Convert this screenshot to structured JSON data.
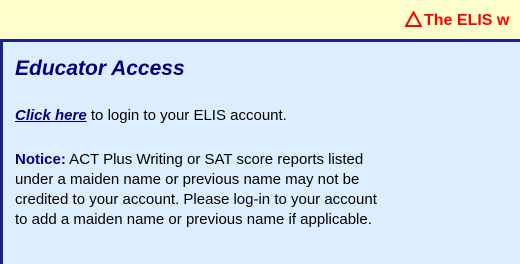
{
  "alert": {
    "icon": "warning-triangle-icon",
    "text": "The ELIS w",
    "color": "#ff0000",
    "background": "#ffffcc"
  },
  "panel": {
    "title": "Educator Access",
    "background": "#ddeeff",
    "accent": "#000080",
    "login_link": "Click here",
    "login_text": " to login to your ELIS account.",
    "notice_label": "Notice:",
    "notice_lines": [
      " ACT Plus Writing or SAT score reports listed",
      "under a maiden name or previous name may not be",
      "credited to your account.  Please log-in to your account",
      "to add a maiden name or previous name if applicable."
    ]
  }
}
